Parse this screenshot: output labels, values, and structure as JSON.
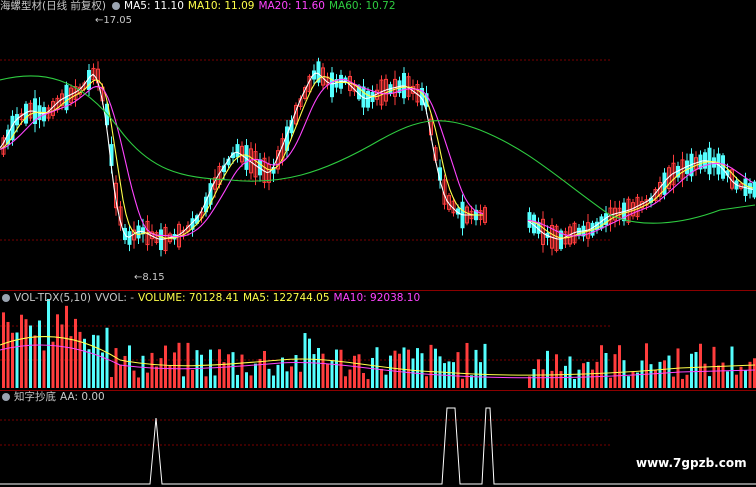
{
  "main": {
    "name": "海螺型材(日线 前复权)",
    "ma5": "MA5: 11.10",
    "ma10": "MA10: 11.09",
    "ma20": "MA20: 11.60",
    "ma60": "MA60: 10.72",
    "high_label": "17.05",
    "low_label": "8.15"
  },
  "vol": {
    "name": "VOL-TDX(5,10)",
    "vvol": "VVOL: -",
    "volume": "VOLUME: 70128.41",
    "ma5": "MA5: 122744.05",
    "ma10": "MA10: 92038.10"
  },
  "ind": {
    "name": "知字抄底",
    "aa": "AA: 0.00"
  },
  "watermark": "www.7gpzb.com",
  "colors": {
    "up": "#ff3d3d",
    "down": "#54ffff",
    "ma5": "#ffffff",
    "ma10": "#ffff4a",
    "ma20": "#ff44ff",
    "ma60": "#2ecc40",
    "grid": "#7a0000"
  }
}
